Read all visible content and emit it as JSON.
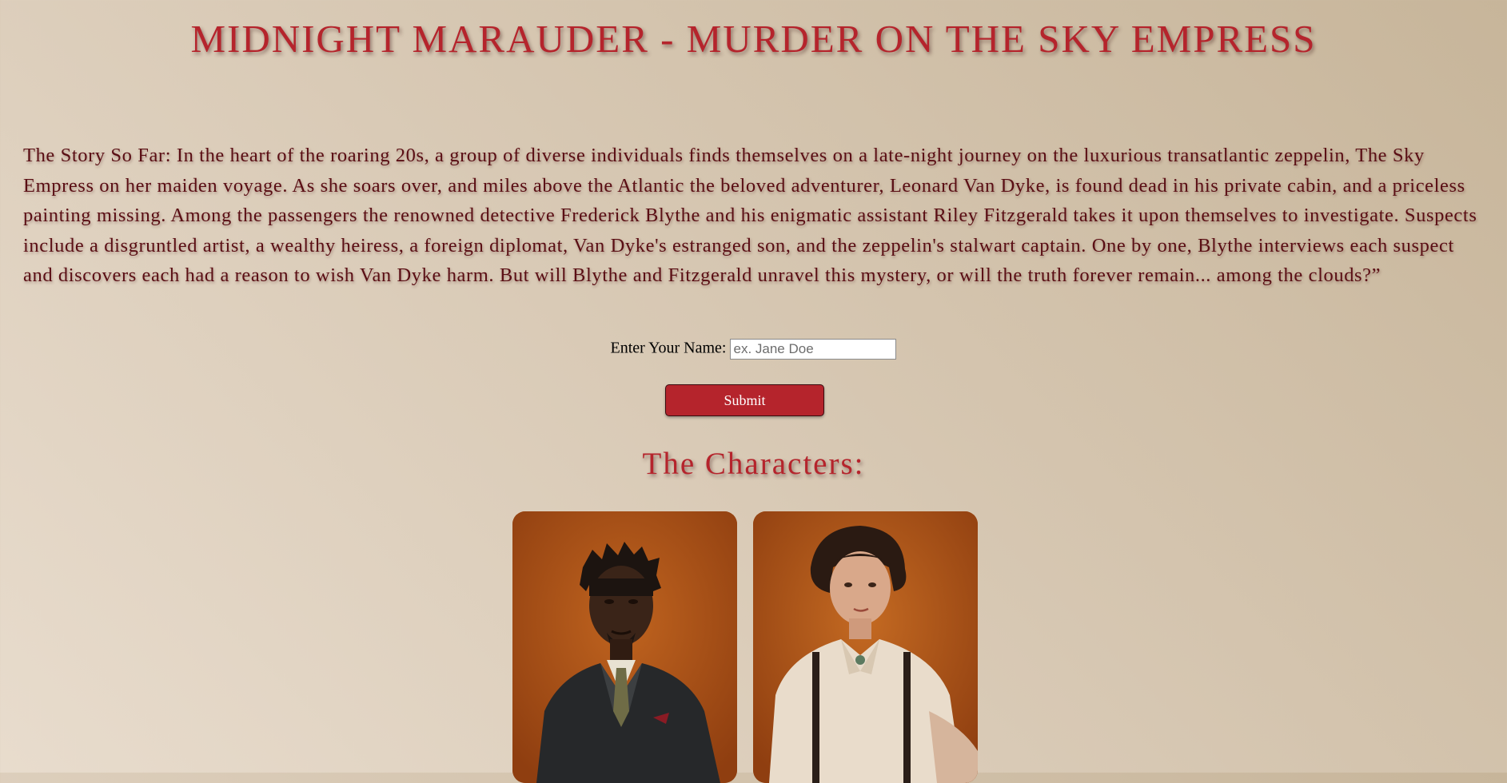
{
  "page": {
    "title": "MIDNIGHT MARAUDER - MURDER ON THE SKY EMPRESS",
    "story": "The Story So Far: In the heart of the roaring 20s, a group of diverse individuals finds themselves on a late-night journey on the luxurious transatlantic zeppelin, The Sky Empress on her maiden voyage. As she soars over, and miles above the Atlantic the beloved adventurer, Leonard Van Dyke, is found dead in his private cabin, and a priceless painting missing. Among the passengers the renowned detective Frederick Blythe and his enigmatic assistant Riley Fitzgerald takes it upon themselves to investigate. Suspects include a disgruntled artist, a wealthy heiress, a foreign diplomat, Van Dyke's estranged son, and the zeppelin's stalwart captain. One by one, Blythe interviews each suspect and discovers each had a reason to wish Van Dyke harm. But will Blythe and Fitzgerald unravel this mystery, or will the truth forever remain... among the clouds?”"
  },
  "form": {
    "name_label": "Enter Your Name:",
    "name_placeholder": "ex. Jane Doe",
    "name_value": "",
    "submit_label": "Submit"
  },
  "characters": {
    "heading": "The Characters:",
    "cards": [
      {
        "portrait": "man-in-suit-portrait"
      },
      {
        "portrait": "woman-with-suspenders-portrait"
      }
    ]
  },
  "colors": {
    "accent": "#b5242c",
    "story_text": "#5a0e14",
    "card_bg": "#b0561c"
  }
}
